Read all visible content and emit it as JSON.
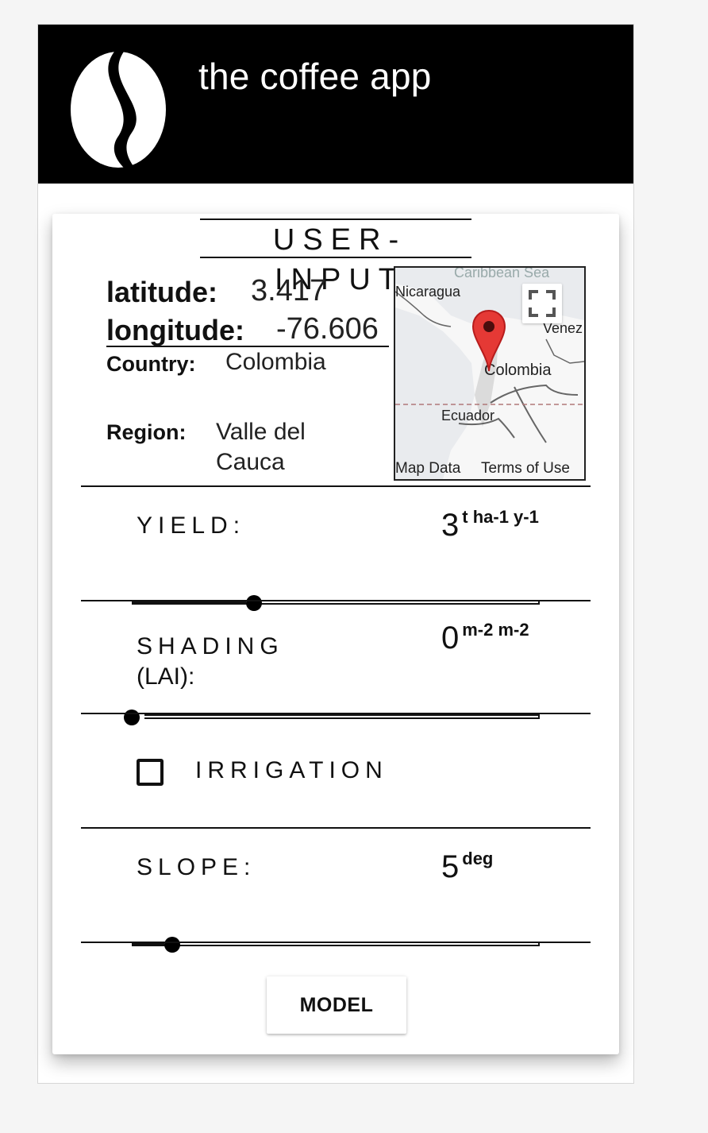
{
  "header": {
    "title": "the coffee app",
    "logo_icon": "coffee-bean-icon"
  },
  "card": {
    "section_title": "USER-INPUT",
    "location": {
      "latitude_label": "latitude:",
      "latitude_value": "3.417",
      "longitude_label": "longitude:",
      "longitude_value": "-76.606",
      "country_label": "Country:",
      "country_value": "Colombia",
      "region_label": "Region:",
      "region_value_line1": "Valle del",
      "region_value_line2": "Cauca"
    },
    "map": {
      "labels": {
        "caribbean": "Caribbean Sea",
        "nicaragua": "Nicaragua",
        "venezuela": "Venez",
        "colombia": "Colombia",
        "ecuador": "Ecuador"
      },
      "footer_data": "Map Data",
      "footer_terms": "Terms of Use",
      "marker_icon": "map-pin-icon",
      "expand_icon": "fullscreen-icon"
    },
    "yield": {
      "label": "YIELD:",
      "value": "3",
      "unit": "t ha-1 y-1",
      "fraction": 0.3
    },
    "shading": {
      "label_line1": "SHADING",
      "label_line2": "(LAI):",
      "value": "0",
      "unit": "m-2 m-2",
      "fraction": 0.0
    },
    "irrigation": {
      "label": "IRRIGATION",
      "checked": false
    },
    "slope": {
      "label": "SLOPE:",
      "value": "5",
      "unit": "deg",
      "fraction": 0.1
    },
    "model_button": "MODEL"
  },
  "colors": {
    "header_bg": "#000000",
    "marker": "#e53935"
  }
}
